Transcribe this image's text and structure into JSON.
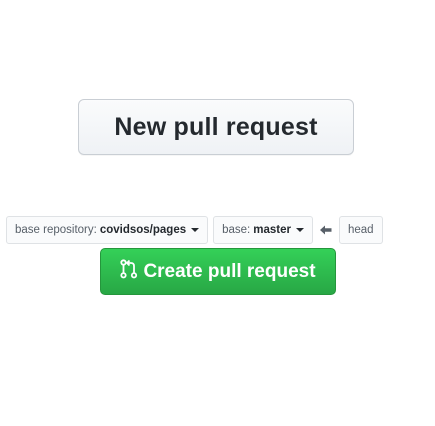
{
  "new_pull_request": {
    "label": "New pull request"
  },
  "range": {
    "base_repo_label": "base repository:",
    "base_repo_value": "covidsos/pages",
    "base_branch_label": "base:",
    "base_branch_value": "master",
    "arrow_icon": "arrow-left-icon",
    "head_label": "head"
  },
  "create_pull_request": {
    "label": "Create pull request",
    "icon": "git-pull-request-icon",
    "color": "#2ea44f"
  }
}
